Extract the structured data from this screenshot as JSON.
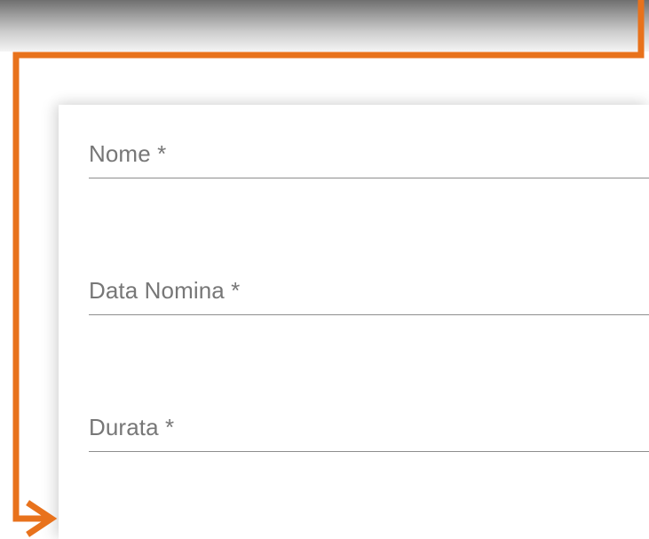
{
  "form": {
    "fields": [
      {
        "label": "Nome *",
        "value": ""
      },
      {
        "label": "Data Nomina *",
        "value": ""
      },
      {
        "label": "Durata *",
        "value": ""
      }
    ]
  },
  "annotation": {
    "arrow_color": "#e8721c"
  }
}
